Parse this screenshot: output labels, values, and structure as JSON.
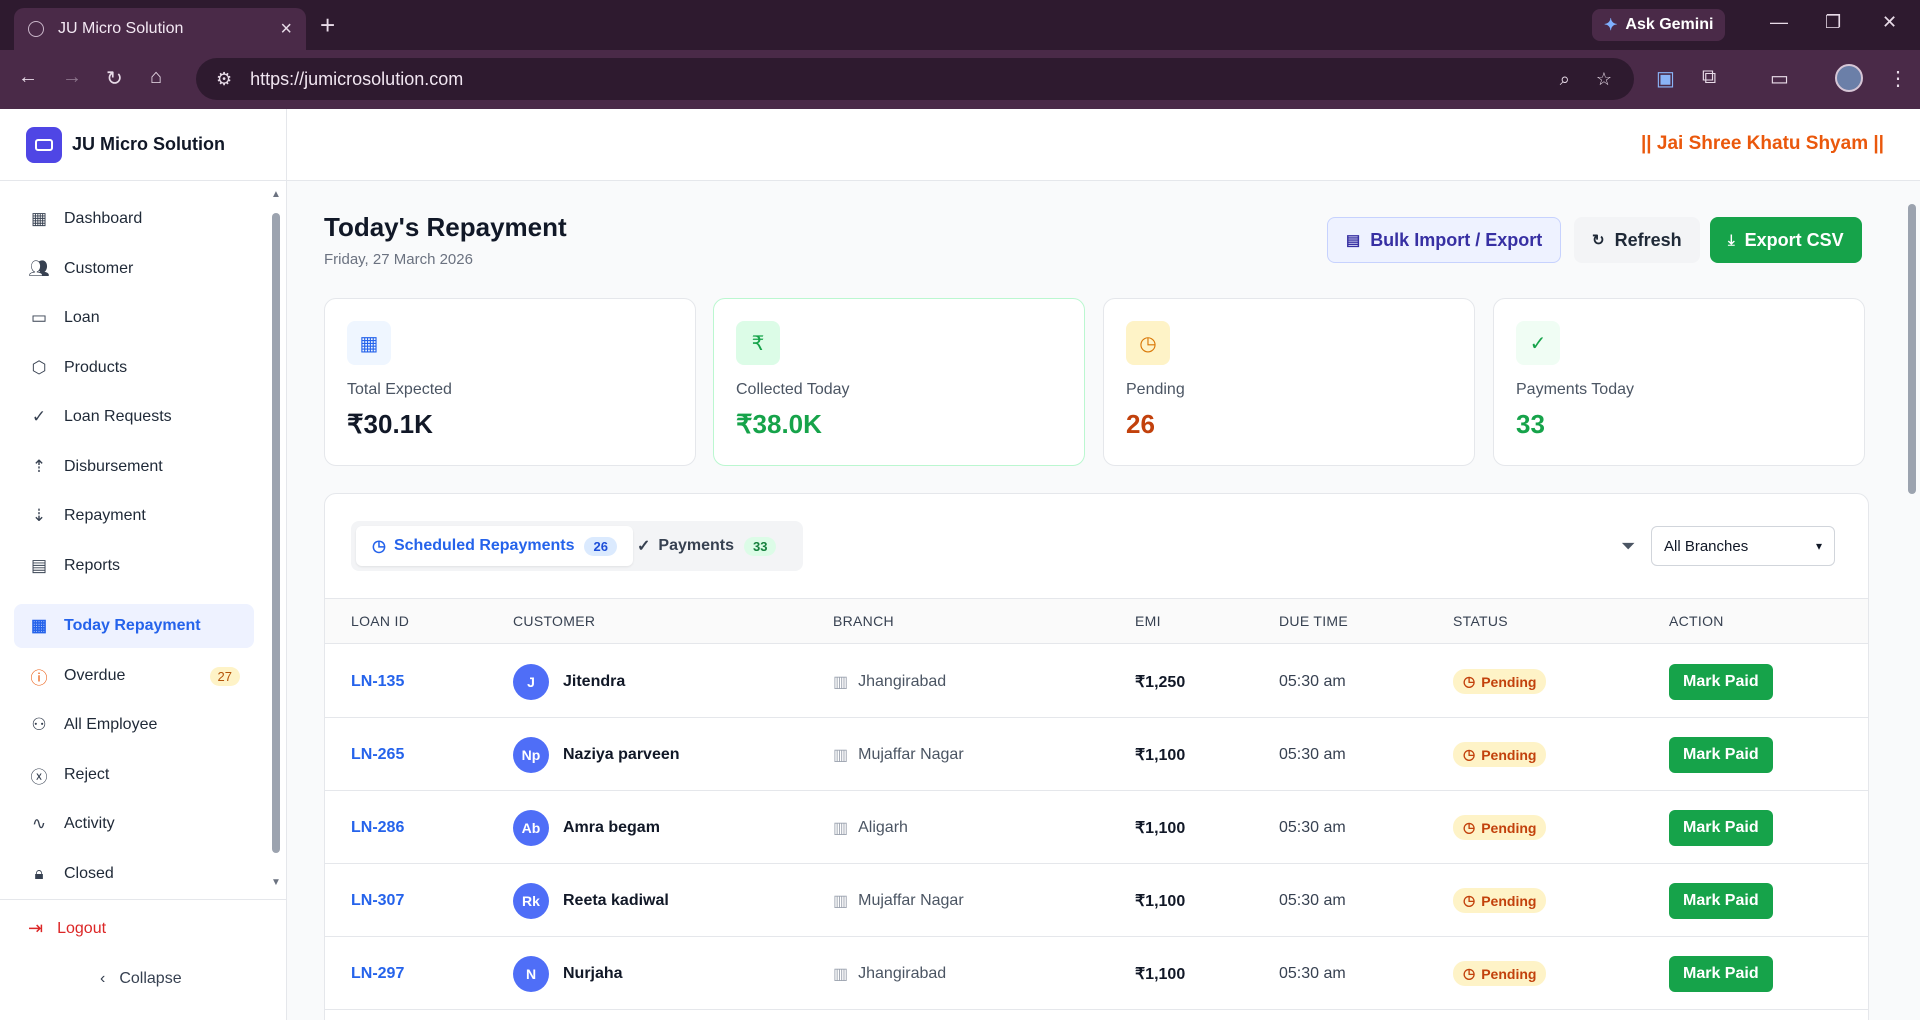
{
  "browser": {
    "tab_title": "JU Micro Solution",
    "url": "https://jumicrosolution.com",
    "gemini_label": "Ask Gemini"
  },
  "brand": {
    "name": "JU Micro Solution"
  },
  "tagline": "|| Jai Shree Khatu Shyam ||",
  "sidebar": {
    "items": [
      {
        "label": "Dashboard",
        "icon": "dashboard-icon"
      },
      {
        "label": "Customer",
        "icon": "users-icon"
      },
      {
        "label": "Loan",
        "icon": "banknote-icon"
      },
      {
        "label": "Products",
        "icon": "package-icon"
      },
      {
        "label": "Loan Requests",
        "icon": "check-circle-icon"
      },
      {
        "label": "Disbursement",
        "icon": "arrow-up-circle-icon"
      },
      {
        "label": "Repayment",
        "icon": "arrow-down-circle-icon"
      },
      {
        "label": "Reports",
        "icon": "file-icon"
      },
      {
        "label": "Today Repayment",
        "icon": "calendar-icon"
      },
      {
        "label": "Overdue",
        "icon": "alert-circle-icon",
        "badge": "27"
      },
      {
        "label": "All Employee",
        "icon": "user-cog-icon"
      },
      {
        "label": "Reject",
        "icon": "x-circle-icon"
      },
      {
        "label": "Activity",
        "icon": "activity-icon"
      },
      {
        "label": "Closed",
        "icon": "lock-icon"
      }
    ],
    "logout": "Logout",
    "collapse": "Collapse"
  },
  "page": {
    "title": "Today's Repayment",
    "date": "Friday, 27 March 2026"
  },
  "actions": {
    "bulk": "Bulk Import / Export",
    "refresh": "Refresh",
    "export": "Export CSV"
  },
  "stats": [
    {
      "label": "Total Expected",
      "value": "₹30.1K",
      "color": "#111827",
      "icon": "calendar-icon"
    },
    {
      "label": "Collected Today",
      "value": "₹38.0K",
      "color": "#16a34a",
      "icon": "rupee-icon"
    },
    {
      "label": "Pending",
      "value": "26",
      "color": "#c2410c",
      "icon": "clock-icon"
    },
    {
      "label": "Payments Today",
      "value": "33",
      "color": "#16a34a",
      "icon": "check-circle-icon"
    }
  ],
  "tabs": [
    {
      "label": "Scheduled Repayments",
      "count": "26"
    },
    {
      "label": "Payments",
      "count": "33"
    }
  ],
  "branch_filter": {
    "selected": "All Branches"
  },
  "table": {
    "headers": [
      "LOAN ID",
      "CUSTOMER",
      "BRANCH",
      "EMI",
      "DUE TIME",
      "STATUS",
      "ACTION"
    ],
    "rows": [
      {
        "loan_id": "LN-135",
        "initials": "J",
        "customer": "Jitendra",
        "branch": "Jhangirabad",
        "emi": "₹1,250",
        "due": "05:30 am",
        "status": "Pending",
        "action": "Mark Paid"
      },
      {
        "loan_id": "LN-265",
        "initials": "Np",
        "customer": "Naziya parveen",
        "branch": "Mujaffar Nagar",
        "emi": "₹1,100",
        "due": "05:30 am",
        "status": "Pending",
        "action": "Mark Paid"
      },
      {
        "loan_id": "LN-286",
        "initials": "Ab",
        "customer": "Amra begam",
        "branch": "Aligarh",
        "emi": "₹1,100",
        "due": "05:30 am",
        "status": "Pending",
        "action": "Mark Paid"
      },
      {
        "loan_id": "LN-307",
        "initials": "Rk",
        "customer": "Reeta kadiwal",
        "branch": "Mujaffar Nagar",
        "emi": "₹1,100",
        "due": "05:30 am",
        "status": "Pending",
        "action": "Mark Paid"
      },
      {
        "loan_id": "LN-297",
        "initials": "N",
        "customer": "Nurjaha",
        "branch": "Jhangirabad",
        "emi": "₹1,100",
        "due": "05:30 am",
        "status": "Pending",
        "action": "Mark Paid"
      }
    ]
  }
}
